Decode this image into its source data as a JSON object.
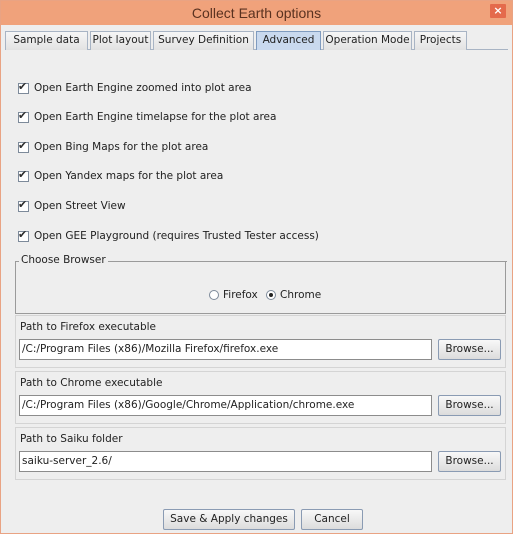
{
  "window": {
    "title": "Collect Earth options",
    "close_label": "×"
  },
  "tabs": [
    {
      "label": "Sample data",
      "active": false
    },
    {
      "label": "Plot layout",
      "active": false
    },
    {
      "label": "Survey Definition",
      "active": false
    },
    {
      "label": "Advanced",
      "active": true
    },
    {
      "label": "Operation Mode",
      "active": false
    },
    {
      "label": "Projects",
      "active": false
    }
  ],
  "options": [
    {
      "label": "Open Earth Engine zoomed into plot area",
      "checked": true
    },
    {
      "label": "Open Earth Engine timelapse for the plot area",
      "checked": true
    },
    {
      "label": "Open Bing Maps for the plot area",
      "checked": true
    },
    {
      "label": "Open Yandex maps for the plot area",
      "checked": true
    },
    {
      "label": "Open Street View",
      "checked": true
    },
    {
      "label": "Open GEE Playground (requires Trusted Tester access)",
      "checked": true
    }
  ],
  "browser": {
    "legend": "Choose Browser",
    "options": [
      {
        "label": "Firefox",
        "selected": false
      },
      {
        "label": "Chrome",
        "selected": true
      }
    ]
  },
  "paths": [
    {
      "label": "Path to Firefox executable",
      "value": "/C:/Program Files (x86)/Mozilla Firefox/firefox.exe",
      "button": "Browse..."
    },
    {
      "label": "Path to Chrome executable",
      "value": "/C:/Program Files (x86)/Google/Chrome/Application/chrome.exe",
      "button": "Browse..."
    },
    {
      "label": "Path to Saiku folder",
      "value": "saiku-server_2.6/",
      "button": "Browse..."
    }
  ],
  "footer": {
    "save_label": "Save & Apply changes",
    "cancel_label": "Cancel"
  },
  "colors": {
    "titlebar": "#f0a27b",
    "close": "#e46a4c",
    "active_tab": "#c9d9ee"
  }
}
